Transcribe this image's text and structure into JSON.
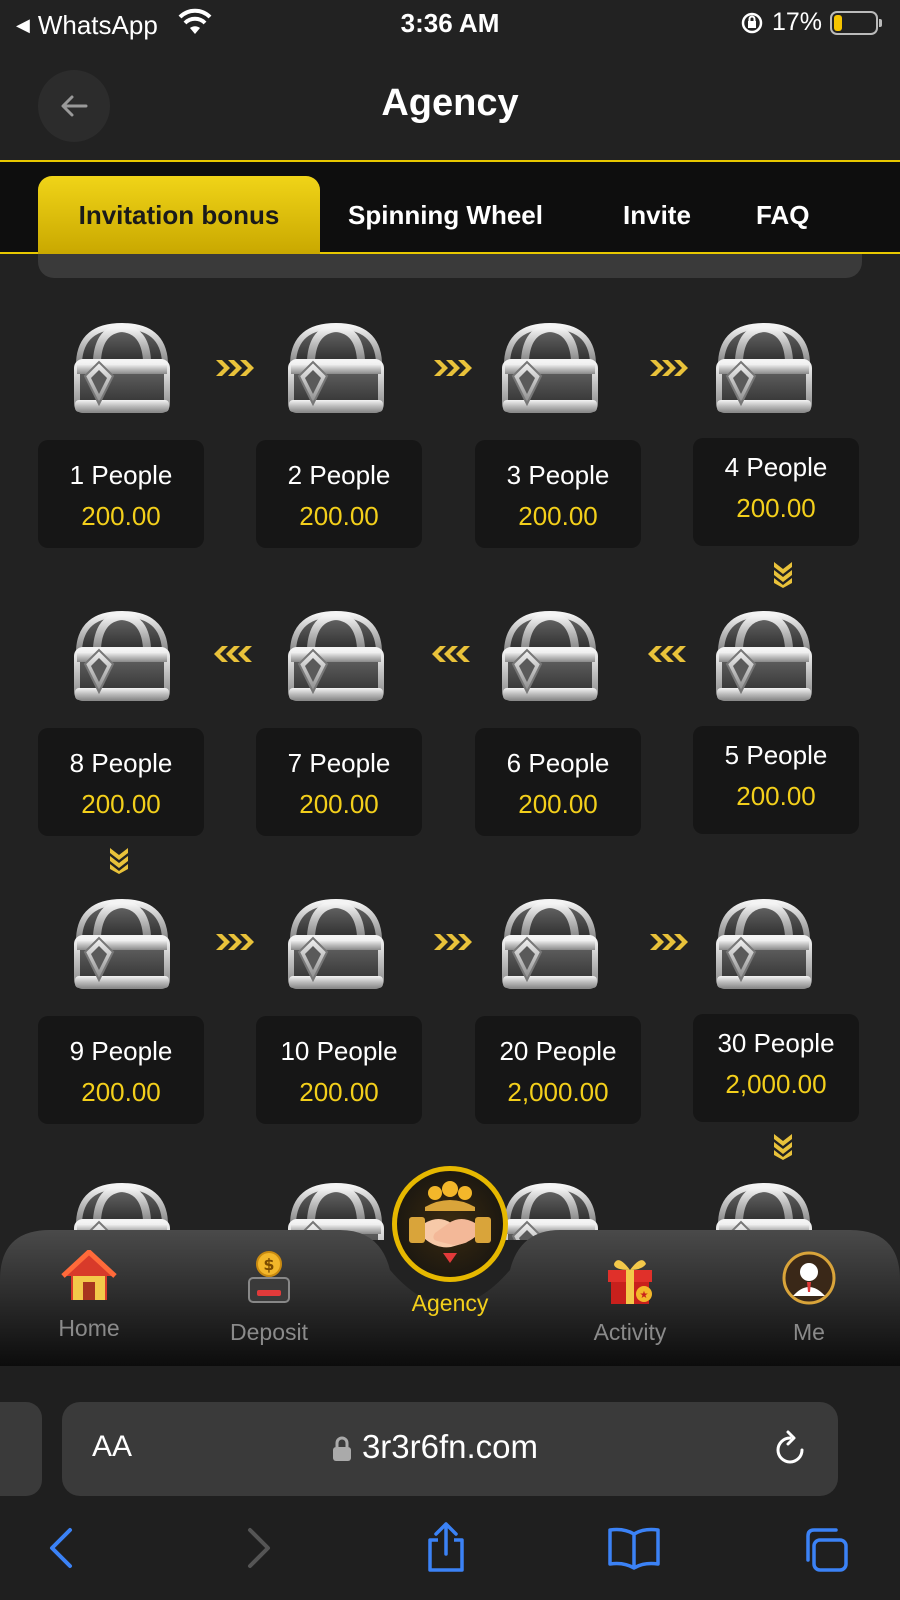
{
  "status": {
    "back_app": "WhatsApp",
    "time": "3:36 AM",
    "battery": "17%",
    "battery_level": 0.17
  },
  "header": {
    "title": "Agency"
  },
  "tabs": [
    {
      "label": "Invitation bonus",
      "active": true
    },
    {
      "label": "Spinning Wheel",
      "active": false
    },
    {
      "label": "Invite",
      "active": false
    },
    {
      "label": "FAQ",
      "active": false
    }
  ],
  "rewards": [
    {
      "people": "1 People",
      "amount": "200.00"
    },
    {
      "people": "2 People",
      "amount": "200.00"
    },
    {
      "people": "3 People",
      "amount": "200.00"
    },
    {
      "people": "4 People",
      "amount": "200.00"
    },
    {
      "people": "5 People",
      "amount": "200.00"
    },
    {
      "people": "6 People",
      "amount": "200.00"
    },
    {
      "people": "7 People",
      "amount": "200.00"
    },
    {
      "people": "8 People",
      "amount": "200.00"
    },
    {
      "people": "9 People",
      "amount": "200.00"
    },
    {
      "people": "10 People",
      "amount": "200.00"
    },
    {
      "people": "20 People",
      "amount": "2,000.00"
    },
    {
      "people": "30 People",
      "amount": "2,000.00"
    }
  ],
  "nav": [
    {
      "label": "Home",
      "icon": "home-icon"
    },
    {
      "label": "Deposit",
      "icon": "deposit-icon"
    },
    {
      "label": "Agency",
      "icon": "agency-handshake-icon",
      "active": true
    },
    {
      "label": "Activity",
      "icon": "gift-icon"
    },
    {
      "label": "Me",
      "icon": "user-avatar-icon"
    }
  ],
  "browser": {
    "aa": "AA",
    "url": "3r3r6fn.com"
  },
  "colors": {
    "accent": "#f3cf1b",
    "background": "#222222",
    "card": "#161616"
  }
}
